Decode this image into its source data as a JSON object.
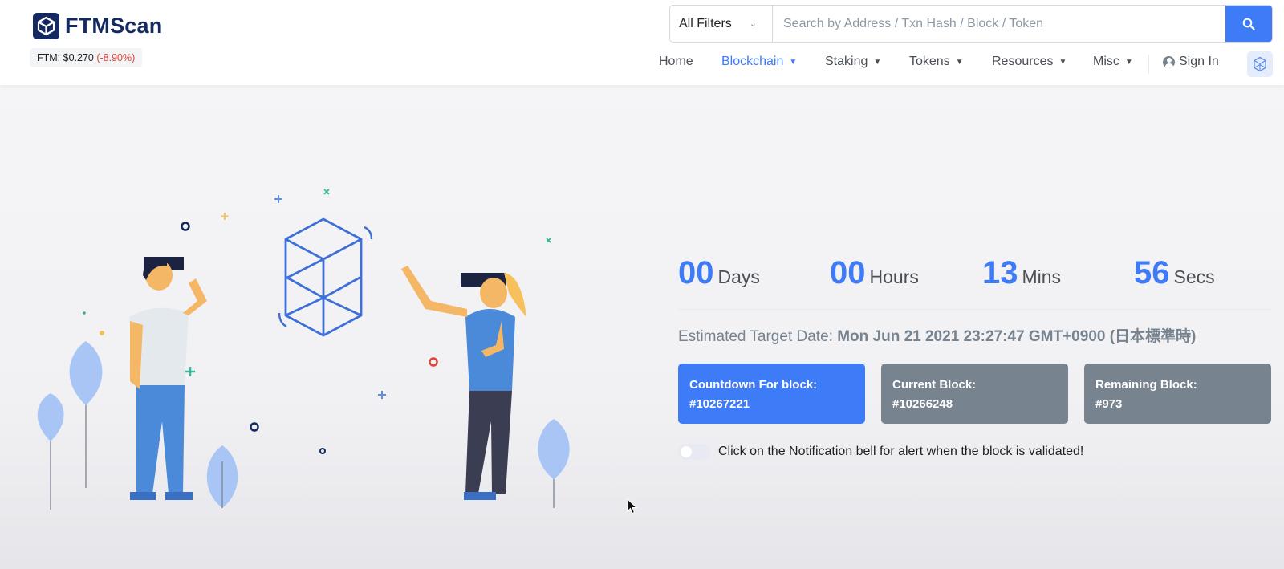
{
  "brand": {
    "name": "FTMScan",
    "price_label": "FTM: $0.270",
    "price_change": "(-8.90%)",
    "colors": {
      "primary": "#3e7bf7",
      "navy": "#13295f",
      "negative": "#de4437",
      "muted": "#77838f"
    }
  },
  "search": {
    "filter_label": "All Filters",
    "placeholder": "Search by Address / Txn Hash / Block / Token",
    "button_icon": "search-icon"
  },
  "nav": {
    "items": [
      {
        "label": "Home",
        "has_dropdown": false,
        "active": false
      },
      {
        "label": "Blockchain",
        "has_dropdown": true,
        "active": true
      },
      {
        "label": "Staking",
        "has_dropdown": true,
        "active": false
      },
      {
        "label": "Tokens",
        "has_dropdown": true,
        "active": false
      },
      {
        "label": "Resources",
        "has_dropdown": true,
        "active": false
      },
      {
        "label": "Misc",
        "has_dropdown": true,
        "active": false
      }
    ],
    "signin_label": "Sign In",
    "network_icon": "fantom-logo-icon"
  },
  "countdown": {
    "days": {
      "value": "00",
      "unit": "Days"
    },
    "hours": {
      "value": "00",
      "unit": "Hours"
    },
    "mins": {
      "value": "13",
      "unit": "Mins"
    },
    "secs": {
      "value": "56",
      "unit": "Secs"
    },
    "target_label": "Estimated Target Date:",
    "target_value": "Mon Jun 21 2021 23:27:47 GMT+0900 (日本標準時)"
  },
  "cards": [
    {
      "label": "Countdown For block:",
      "value": "#10267221"
    },
    {
      "label": "Current Block:",
      "value": "#10266248"
    },
    {
      "label": "Remaining Block:",
      "value": "#973"
    }
  ],
  "notification": {
    "text": "Click on the Notification bell for alert when the block is validated!",
    "toggle_on": false
  }
}
